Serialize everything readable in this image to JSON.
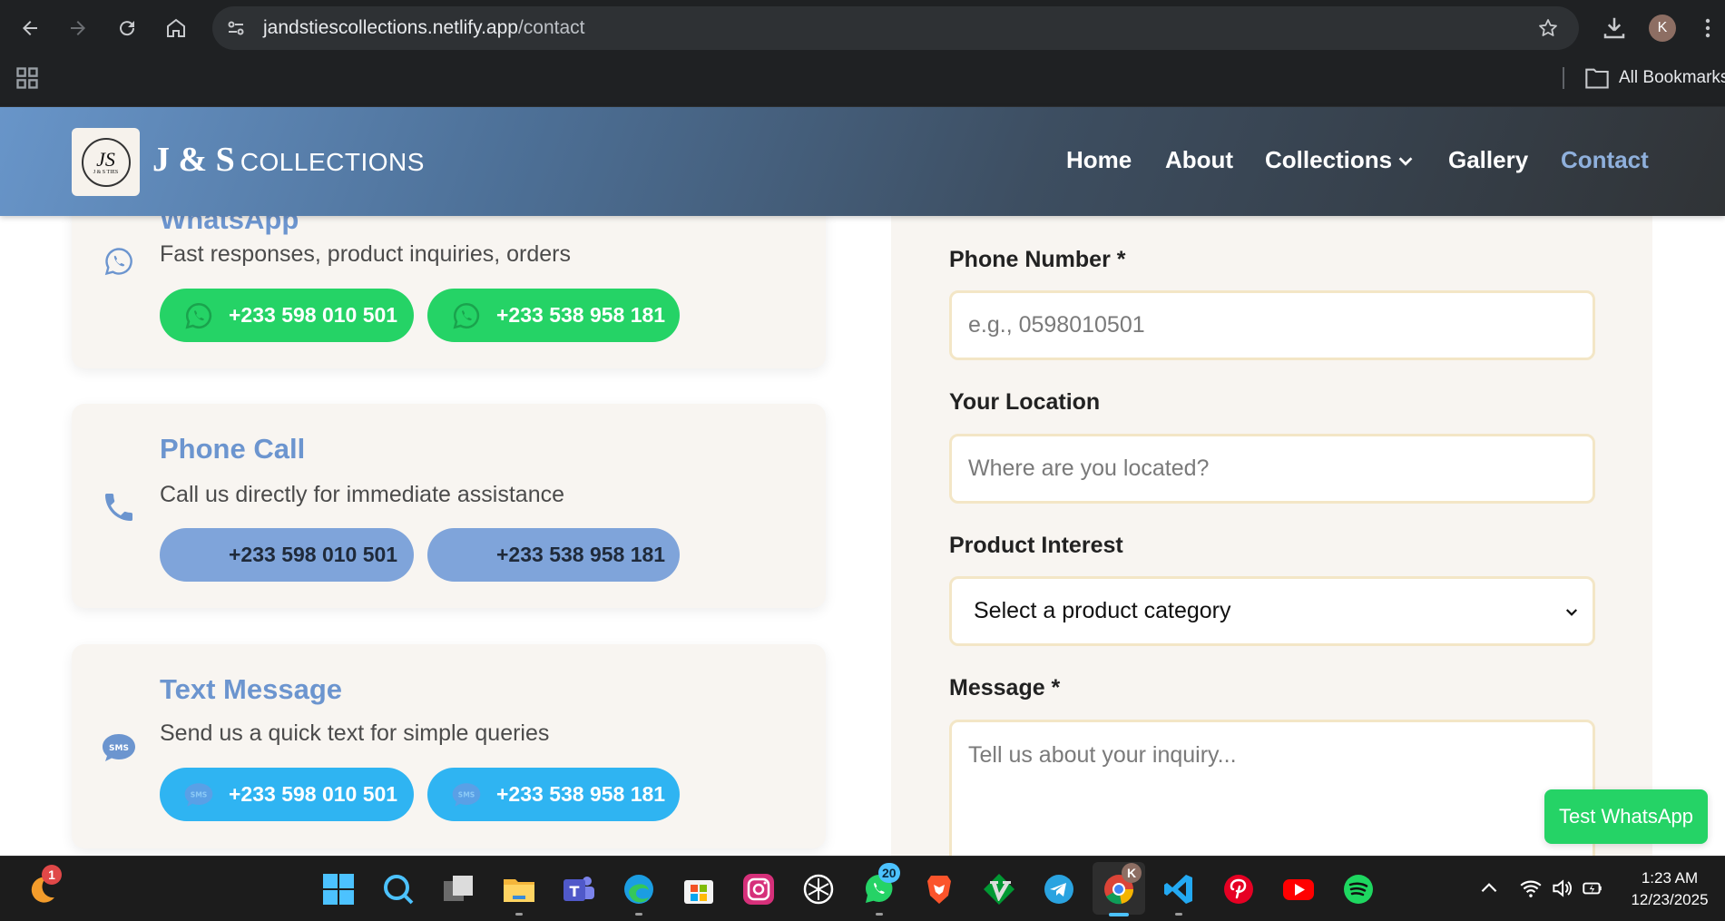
{
  "browser": {
    "url_host": "jandstiescollections.netlify.app",
    "url_path": "/contact",
    "profile_initial": "K",
    "bookmarks_label": "All Bookmarks"
  },
  "header": {
    "brand_mark": "J & S",
    "brand_text": "COLLECTIONS",
    "logo_monogram": "JS",
    "logo_small_text": "J & S TIES",
    "nav": [
      "Home",
      "About",
      "Collections",
      "Gallery",
      "Contact"
    ],
    "active": "Contact"
  },
  "contact_methods": [
    {
      "title": "WhatsApp",
      "description": "Fast responses, product inquiries, orders",
      "numbers": [
        "+233 598 010 501",
        "+233 538 958 181"
      ],
      "color": "#25d366"
    },
    {
      "title": "Phone Call",
      "description": "Call us directly for immediate assistance",
      "numbers": [
        "+233 598 010 501",
        "+233 538 958 181"
      ],
      "color": "#7fa4da"
    },
    {
      "title": "Text Message",
      "description": "Send us a quick text for simple queries",
      "numbers": [
        "+233 598 010 501",
        "+233 538 958 181"
      ],
      "color": "#2fb4f2"
    }
  ],
  "form": {
    "phone_label": "Phone Number *",
    "phone_placeholder": "e.g., 0598010501",
    "location_label": "Your Location",
    "location_placeholder": "Where are you located?",
    "interest_label": "Product Interest",
    "interest_selected": "Select a product category",
    "message_label": "Message *",
    "message_placeholder": "Tell us about your inquiry..."
  },
  "floating_button": "Test WhatsApp",
  "taskbar": {
    "apps": [
      "Start",
      "Search",
      "Task View",
      "File Explorer",
      "Teams",
      "Edge",
      "Microsoft Store",
      "Instagram",
      "ChatGPT",
      "WhatsApp",
      "Brave",
      "Vim",
      "Telegram",
      "Chrome",
      "VS Code",
      "Pinterest",
      "YouTube",
      "Spotify"
    ],
    "left_widget_badge": "1",
    "whatsapp_badge": "20",
    "chrome_profile_badge": "K",
    "time": "1:23 AM",
    "date": "12/23/2025"
  },
  "colors": {
    "accent": "#6c95cf",
    "whatsapp_green": "#25d366",
    "call_blue": "#7fa4da",
    "sms_blue": "#2fb4f2",
    "card_bg": "#f8f5f1",
    "input_border": "#f3e6c6"
  }
}
